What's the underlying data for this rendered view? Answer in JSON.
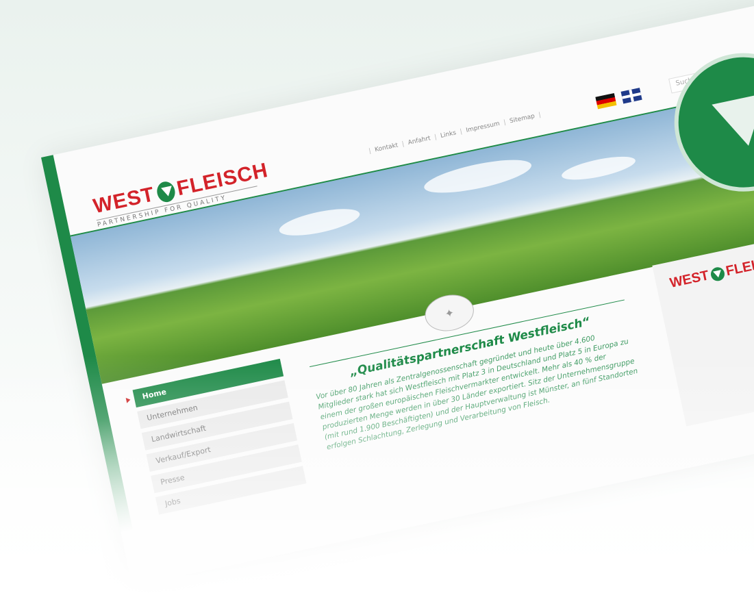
{
  "brand": {
    "logo_left": "WEST",
    "logo_right": "FLEISCH",
    "tagline": "PARTNERSHIP FOR QUALITY"
  },
  "topnav": [
    "Kontakt",
    "Anfahrt",
    "Links",
    "Impressum",
    "Sitemap"
  ],
  "search": {
    "placeholder": "Suche"
  },
  "menu": {
    "items": [
      "Home",
      "Unternehmen",
      "Landwirtschaft",
      "Verkauf/Export",
      "Presse",
      "Jobs"
    ]
  },
  "content": {
    "headline": "„Qualitätspartnerschaft Westfleisch“",
    "paragraph": "Vor über 80 Jahren als Zentralgenossenschaft gegründet und heute über 4.600 Mitglieder stark hat sich Westfleisch mit Platz 3 in Deutschland und Platz 5 in Europa zu einem der großen europäischen Fleischvermarkter entwickelt. Mehr als 40 % der produzierten Menge werden in über 30 Länder exportiert. Sitz der Unternehmensgruppe (mit rund 1.900 Beschäftigten) und der Hauptverwaltung ist Münster, an fünf Standorten erfolgen Schlachtung, Zerlegung und Verarbeitung von Fleisch."
  },
  "colors": {
    "brand_green": "#1e8a48",
    "brand_red": "#d3232a"
  }
}
